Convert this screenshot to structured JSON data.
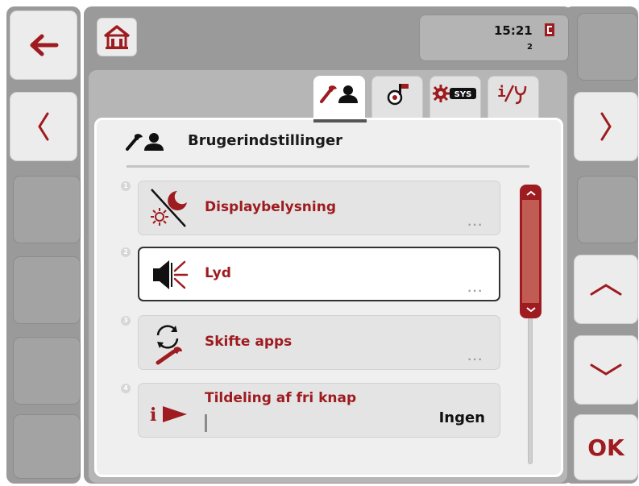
{
  "status": {
    "time": "15:21",
    "count": "2"
  },
  "panel": {
    "title": "Brugerindstillinger"
  },
  "tabs": [
    {
      "name": "user-settings",
      "icon": "wrench-person-icon",
      "active": true
    },
    {
      "name": "country-settings",
      "icon": "globe-flag-icon",
      "active": false
    },
    {
      "name": "system-settings",
      "icon": "gear-sys-icon",
      "active": false
    },
    {
      "name": "info-diagnostics",
      "icon": "info-stethoscope-icon",
      "active": false
    }
  ],
  "list": {
    "items": [
      {
        "num": "1",
        "label": "Displaybelysning",
        "more": "...",
        "icon": "display-lighting-icon"
      },
      {
        "num": "2",
        "label": "Lyd",
        "more": "...",
        "icon": "speaker-icon",
        "selected": true
      },
      {
        "num": "3",
        "label": "Skifte apps",
        "more": "...",
        "icon": "switch-apps-icon"
      },
      {
        "num": "4",
        "label": "Tildeling af fri knap",
        "value": "Ingen",
        "icon": "info-play-icon"
      }
    ]
  },
  "softkeys": {
    "ok_label": "OK"
  },
  "colors": {
    "accent": "#9e1b1f",
    "background": "#9a9a9a",
    "panel": "#efefef"
  }
}
